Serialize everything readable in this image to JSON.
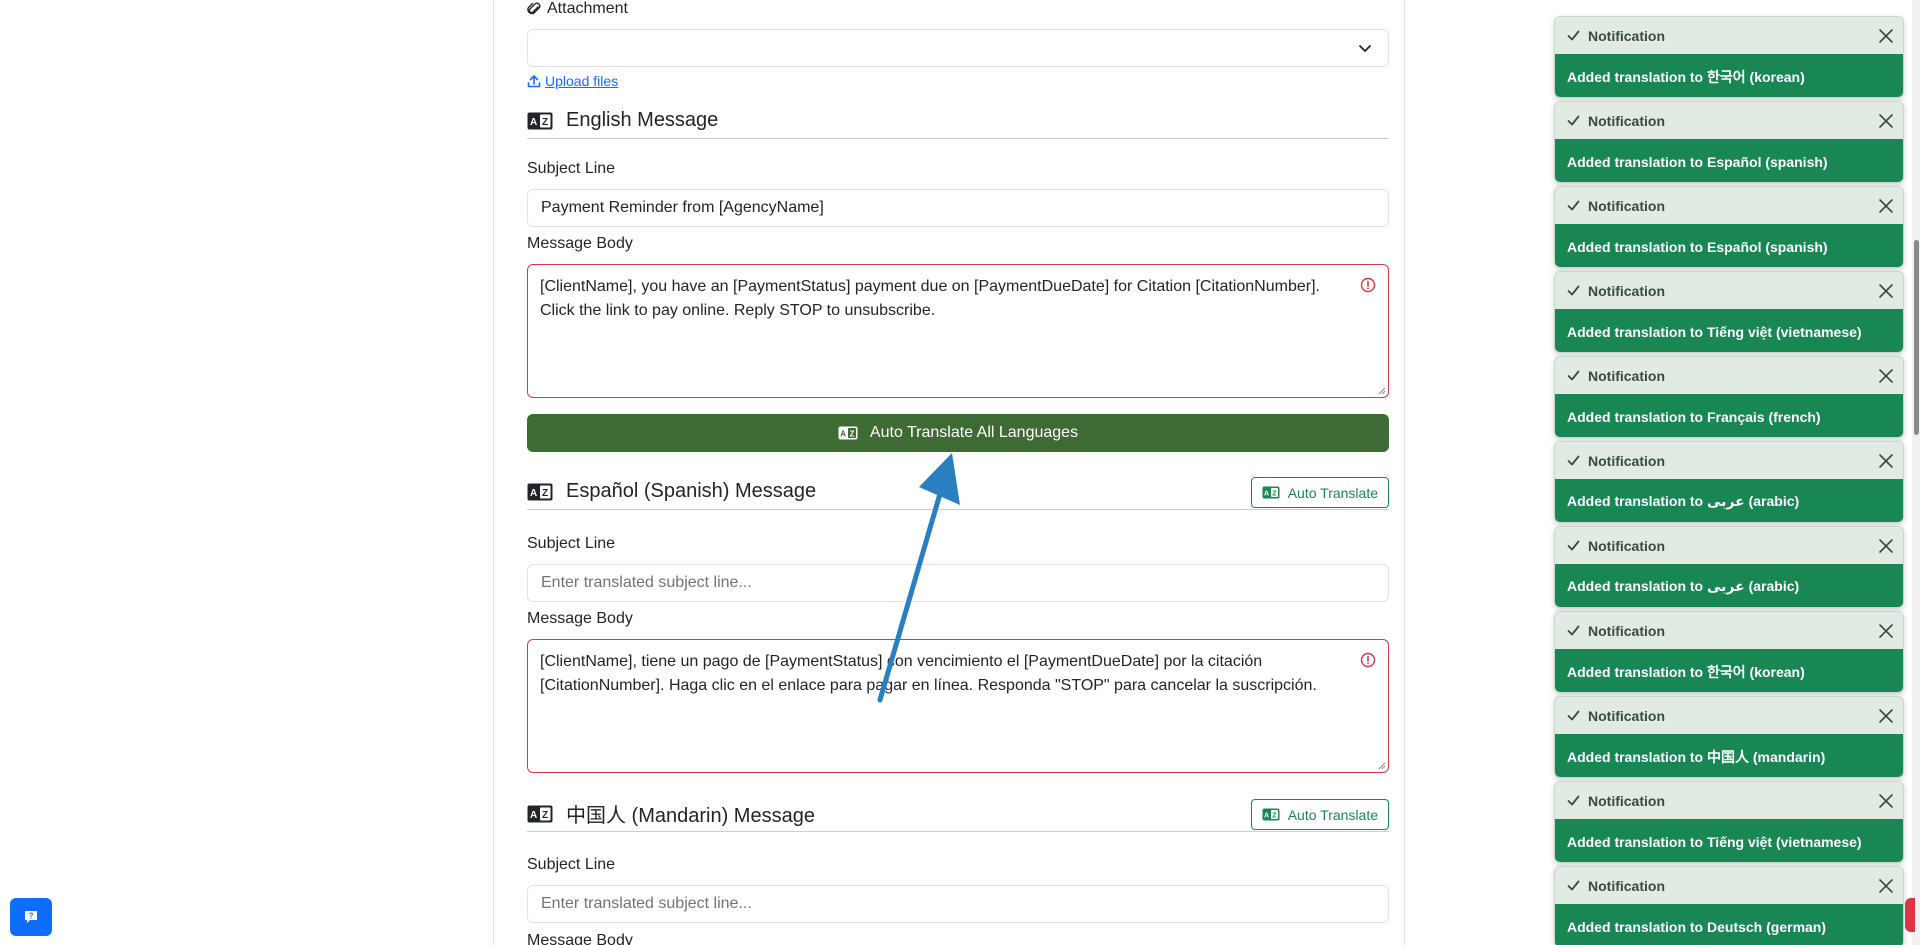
{
  "attachment": {
    "label": "Attachment",
    "upload_label": " Upload files"
  },
  "english": {
    "title": "English Message",
    "subject_label": "Subject Line",
    "subject_value": "Payment Reminder from [AgencyName]",
    "body_label": "Message Body",
    "body_value": "[ClientName], you have an [PaymentStatus] payment due on [PaymentDueDate] for Citation [CitationNumber]. Click the link to pay online. Reply STOP to unsubscribe."
  },
  "auto_translate_all_label": "Auto Translate All Languages",
  "spanish": {
    "title": "Español (Spanish) Message",
    "auto_translate_label": "Auto Translate",
    "subject_label": "Subject Line",
    "subject_placeholder": "Enter translated subject line...",
    "body_label": "Message Body",
    "body_value": "[ClientName], tiene un pago de [PaymentStatus] con vencimiento el [PaymentDueDate] por la citación [CitationNumber]. Haga clic en el enlace para pagar en línea. Responda \"STOP\" para cancelar la suscripción."
  },
  "mandarin": {
    "title": "中国人 (Mandarin) Message",
    "auto_translate_label": "Auto Translate",
    "subject_label": "Subject Line",
    "subject_placeholder": "Enter translated subject line...",
    "body_label": "Message Body"
  },
  "toasts": [
    {
      "title": "Notification",
      "message": "Added translation to 한국어 (korean)"
    },
    {
      "title": "Notification",
      "message": "Added translation to Español (spanish)"
    },
    {
      "title": "Notification",
      "message": "Added translation to Español (spanish)"
    },
    {
      "title": "Notification",
      "message": "Added translation to Tiếng việt (vietnamese)"
    },
    {
      "title": "Notification",
      "message": "Added translation to Français (french)"
    },
    {
      "title": "Notification",
      "message": "Added translation to عربى (arabic)"
    },
    {
      "title": "Notification",
      "message": "Added translation to عربى (arabic)"
    },
    {
      "title": "Notification",
      "message": "Added translation to 한국어 (korean)"
    },
    {
      "title": "Notification",
      "message": "Added translation to 中国人 (mandarin)"
    },
    {
      "title": "Notification",
      "message": "Added translation to Tiếng việt (vietnamese)"
    },
    {
      "title": "Notification",
      "message": "Added translation to Deutsch (german)"
    }
  ],
  "colors": {
    "primary_button": "#3d6b33",
    "success": "#198754",
    "toast_header": "#e1ebe4",
    "error_border": "#dc3545",
    "link": "#0d6efd",
    "annotation_arrow": "#2a7fc1"
  },
  "icons": {
    "attachment": "paperclip-icon",
    "upload": "upload-icon",
    "translate": "translate-az-icon",
    "error": "exclamation-circle-icon",
    "toast_check": "check-icon",
    "toast_close": "close-icon",
    "help": "help-chat-icon"
  }
}
